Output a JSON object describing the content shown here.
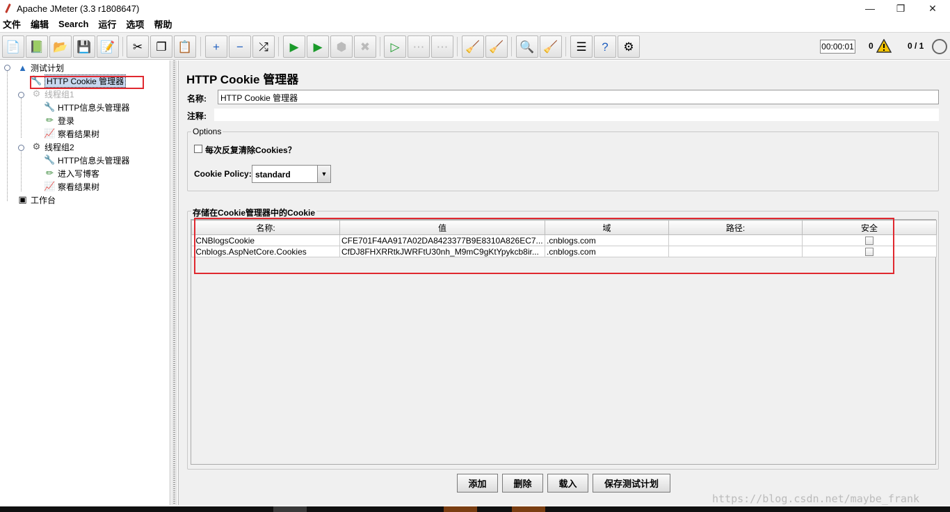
{
  "window": {
    "title": "Apache JMeter (3.3 r1808647)"
  },
  "menu": [
    "文件",
    "编辑",
    "Search",
    "运行",
    "选项",
    "帮助"
  ],
  "toolbar": {
    "elapsed": "00:00:01",
    "warnings": "0",
    "threads": "0 / 1"
  },
  "tree": {
    "test_plan": "测试计划",
    "cookie_manager": "HTTP Cookie 管理器",
    "group1": "线程组1",
    "group1_header": "HTTP信息头管理器",
    "group1_login": "登录",
    "group1_results": "察看结果树",
    "group2": "线程组2",
    "group2_header": "HTTP信息头管理器",
    "group2_blog": "进入写博客",
    "group2_results": "察看结果树",
    "workbench": "工作台"
  },
  "panel": {
    "title": "HTTP Cookie 管理器",
    "name_label": "名称:",
    "name_value": "HTTP Cookie 管理器",
    "comment_label": "注释:",
    "options_title": "Options",
    "clear_each_iteration": "每次反复清除Cookies？",
    "policy_label": "Cookie Policy:",
    "policy_value": "standard",
    "stored_title": "存储在Cookie管理器中的Cookie"
  },
  "cookies": {
    "headers": [
      "名称:",
      "值",
      "域",
      "路径:",
      "安全"
    ],
    "rows": [
      {
        "name": ".CNBlogsCookie",
        "value": "CFE701F4AA917A02DA8423377B9E8310A826EC7...",
        "domain": ".cnblogs.com",
        "path": "",
        "secure": false
      },
      {
        "name": ".Cnblogs.AspNetCore.Cookies",
        "value": "CfDJ8FHXRRtkJWRFtU30nh_M9mC9gKtYpykcb8ir...",
        "domain": ".cnblogs.com",
        "path": "",
        "secure": false
      }
    ]
  },
  "buttons": {
    "add": "添加",
    "delete": "删除",
    "load": "载入",
    "save": "保存测试计划"
  },
  "watermark": "https://blog.csdn.net/maybe_frank",
  "colors": {
    "highlight_box": "#e0282f",
    "selection": "#c8d8f0"
  }
}
